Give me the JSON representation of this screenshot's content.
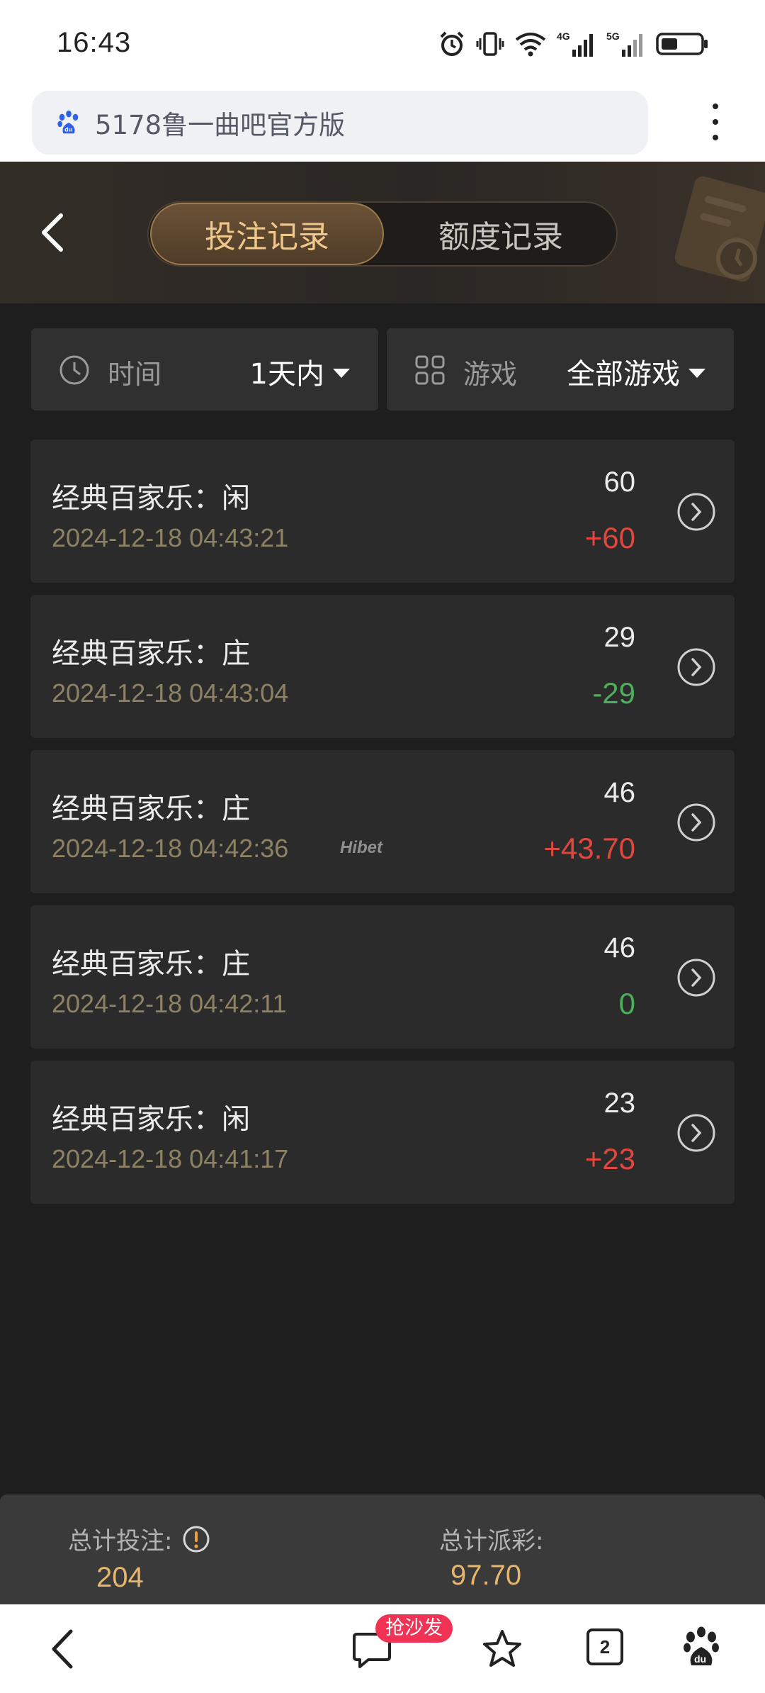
{
  "status_bar": {
    "time": "16:43",
    "icons": [
      "alarm-icon",
      "vibrate-icon",
      "wifi-icon",
      "signal-4g-icon",
      "signal-5g-icon",
      "battery-icon"
    ]
  },
  "browser": {
    "url": "5178鲁一曲吧官方版",
    "logo_icon": "baidu-paw-icon"
  },
  "header": {
    "tabs": [
      {
        "label": "投注记录",
        "active": true
      },
      {
        "label": "额度记录",
        "active": false
      }
    ]
  },
  "filters": {
    "time": {
      "label": "时间",
      "value": "1天内"
    },
    "game": {
      "label": "游戏",
      "value": "全部游戏"
    }
  },
  "records": [
    {
      "title": "经典百家乐：闲",
      "time": "2024-12-18 04:43:21",
      "amount": "60",
      "result": "+60",
      "result_type": "positive"
    },
    {
      "title": "经典百家乐：庄",
      "time": "2024-12-18 04:43:04",
      "amount": "29",
      "result": "-29",
      "result_type": "negative"
    },
    {
      "title": "经典百家乐：庄",
      "time": "2024-12-18 04:42:36",
      "amount": "46",
      "result": "+43.70",
      "result_type": "positive"
    },
    {
      "title": "经典百家乐：庄",
      "time": "2024-12-18 04:42:11",
      "amount": "46",
      "result": "0",
      "result_type": "zero"
    },
    {
      "title": "经典百家乐：闲",
      "time": "2024-12-18 04:41:17",
      "amount": "23",
      "result": "+23",
      "result_type": "positive"
    }
  ],
  "watermark": "Hibet",
  "summary": {
    "total_bet_label": "总计投注:",
    "total_bet_value": "204",
    "total_payout_label": "总计派彩:",
    "total_payout_value": "97.70"
  },
  "bottom_nav": {
    "comment_badge": "抢沙发",
    "tab_count": "2"
  },
  "colors": {
    "positive": "#e0473f",
    "negative": "#4caf5a",
    "accent_gold": "#e6b66c"
  }
}
